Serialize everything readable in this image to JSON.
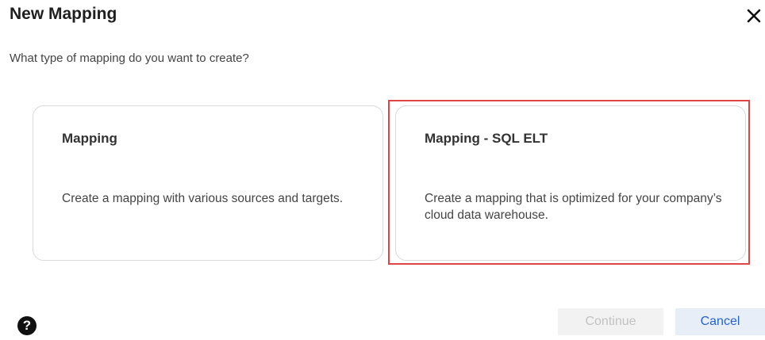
{
  "dialog": {
    "title": "New Mapping",
    "subtitle": "What type of mapping do you want to create?",
    "close_icon": "close-icon",
    "help_icon": "help-icon",
    "help_glyph": "?"
  },
  "options": [
    {
      "title": "Mapping",
      "description": "Create a mapping with various sources and targets."
    },
    {
      "title": "Mapping - SQL ELT",
      "description": "Create a mapping that is optimized for your company’s cloud data warehouse."
    }
  ],
  "footer": {
    "continue_label": "Continue",
    "cancel_label": "Cancel"
  },
  "colors": {
    "highlight": "#e04545",
    "cancel_text": "#2563c9",
    "cancel_bg": "#e8eef8",
    "continue_disabled_bg": "#f2f2f2",
    "continue_disabled_text": "#c2c2c2"
  }
}
